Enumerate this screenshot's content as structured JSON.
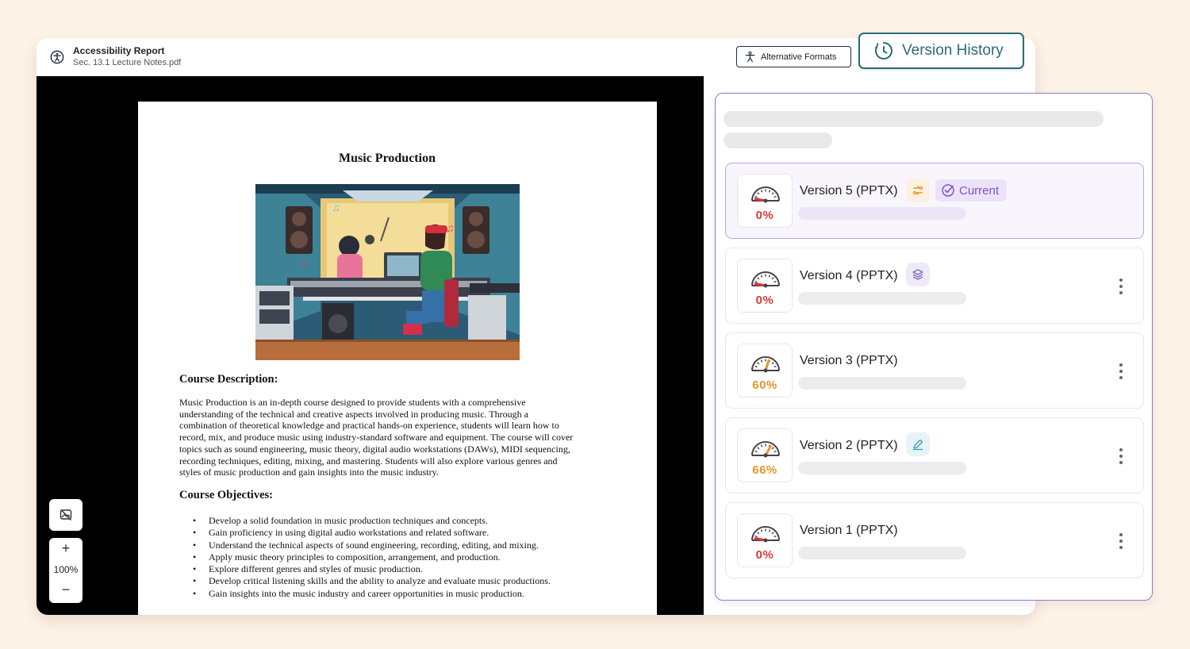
{
  "app": {
    "title": "Accessibility Report",
    "filename": "Sec. 13.1 Lecture Notes.pdf",
    "alt_formats_label": "Alternative Formats",
    "version_history_label": "Version History"
  },
  "document": {
    "title": "Music Production",
    "description_heading": "Course Description:",
    "description_lines": [
      "Music Production is an in-depth course designed to provide students with a comprehensive",
      "understanding of the technical and creative aspects involved in producing music. Through a",
      "combination of theoretical knowledge and practical hands-on experience, students will learn how to",
      "record, mix, and produce music using industry-standard software and equipment. The course will cover",
      "topics such as sound engineering, music theory, digital audio workstations (DAWs), MIDI sequencing,",
      "recording techniques, editing, mixing, and mastering. Students will also explore various genres and",
      "styles of music production and gain insights into the music industry."
    ],
    "objectives_heading": "Course Objectives:",
    "objectives": [
      "Develop a solid foundation in music production techniques and concepts.",
      "Gain proficiency in using digital audio workstations and related software.",
      "Understand the technical aspects of sound engineering, recording, editing, and mixing.",
      "Apply music theory principles to composition, arrangement, and production.",
      "Explore different genres and styles of music production.",
      "Develop critical listening skills and the ability to analyze and evaluate music productions.",
      "Gain insights into the music industry and career opportunities in music production."
    ]
  },
  "viewer": {
    "zoom_level": "100%",
    "zoom_in": "+",
    "zoom_out": "−"
  },
  "versions": [
    {
      "name": "Version 5 (PPTX)",
      "score": 0,
      "score_label": "0%",
      "current": true,
      "current_label": "Current",
      "tag_icon": "conversion-icon",
      "score_color": "#d63a3a"
    },
    {
      "name": "Version 4 (PPTX)",
      "score": 0,
      "score_label": "0%",
      "current": false,
      "tag_icon": "layers-icon",
      "score_color": "#d63a3a"
    },
    {
      "name": "Version 3 (PPTX)",
      "score": 60,
      "score_label": "60%",
      "current": false,
      "tag_icon": "",
      "score_color": "#e0962a"
    },
    {
      "name": "Version 2 (PPTX)",
      "score": 66,
      "score_label": "66%",
      "current": false,
      "tag_icon": "edit-icon",
      "score_color": "#e0962a"
    },
    {
      "name": "Version 1 (PPTX)",
      "score": 0,
      "score_label": "0%",
      "current": false,
      "tag_icon": "",
      "score_color": "#d63a3a"
    }
  ]
}
